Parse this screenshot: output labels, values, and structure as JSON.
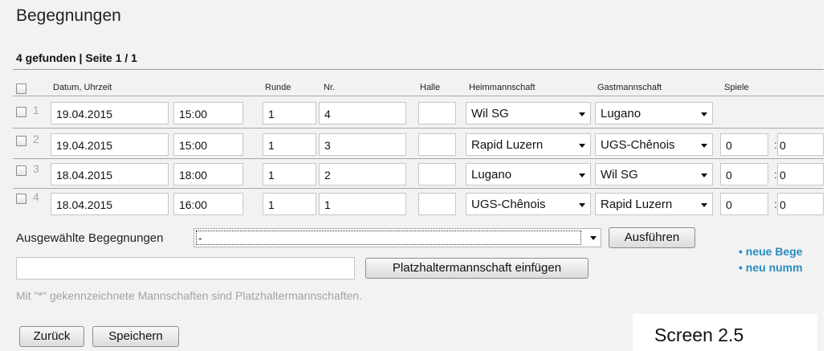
{
  "page": {
    "title": "Begegnungen",
    "result_info": "4 gefunden | Seite 1 / 1"
  },
  "table": {
    "headers": {
      "datum": "Datum, Uhrzeit",
      "runde": "Runde",
      "nr": "Nr.",
      "halle": "Halle",
      "heim": "Heimmannschaft",
      "gast": "Gastmannschaft",
      "spiele": "Spiele"
    },
    "rows": [
      {
        "num": "1",
        "date": "19.04.2015",
        "time": "15:00",
        "runde": "1",
        "nr": "4",
        "halle": "",
        "heim": "Wil SG",
        "gast": "Lugano",
        "score_home": "",
        "score_away": ""
      },
      {
        "num": "2",
        "date": "19.04.2015",
        "time": "15:00",
        "runde": "1",
        "nr": "3",
        "halle": "",
        "heim": "Rapid Luzern",
        "gast": "UGS-Chênois",
        "score_home": "0",
        "score_away": "0"
      },
      {
        "num": "3",
        "date": "18.04.2015",
        "time": "18:00",
        "runde": "1",
        "nr": "2",
        "halle": "",
        "heim": "Lugano",
        "gast": "Wil SG",
        "score_home": "0",
        "score_away": "0"
      },
      {
        "num": "4",
        "date": "18.04.2015",
        "time": "16:00",
        "runde": "1",
        "nr": "1",
        "halle": "",
        "heim": "UGS-Chênois",
        "gast": "Rapid Luzern",
        "score_home": "0",
        "score_away": "0"
      }
    ]
  },
  "bulk": {
    "label": "Ausgewählte Begegnungen",
    "selected": "-",
    "execute": "Ausführen"
  },
  "placeholder_team": {
    "value": "",
    "button": "Platzhaltermannschaft einfügen"
  },
  "hint": "Mit \"*\" gekennzeichnete Mannschaften sind Platzhaltermannschaften.",
  "links": [
    "neue Bege",
    "neu numm"
  ],
  "buttons": {
    "back": "Zurück",
    "save": "Speichern"
  },
  "caption": "Screen 2.5",
  "colors": {
    "link": "#2a8cc0",
    "panel": "#f2f2f2",
    "hint": "#a3a3a3"
  }
}
